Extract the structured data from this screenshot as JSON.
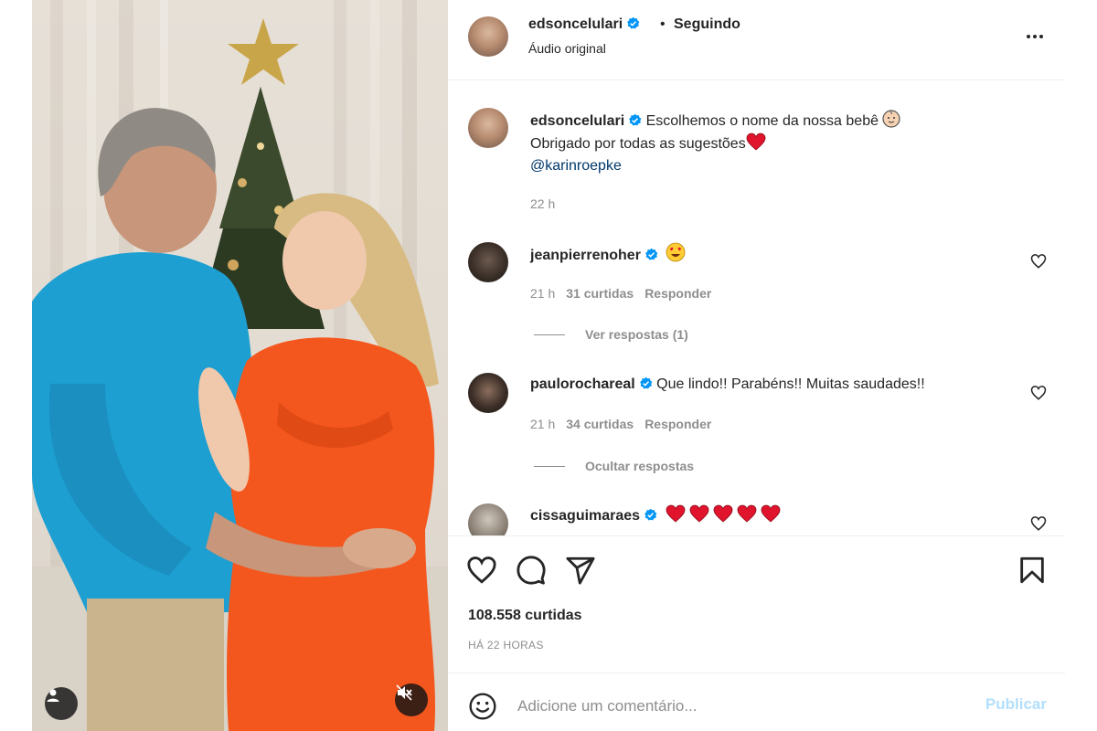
{
  "header": {
    "username": "edsoncelulari",
    "dot": "•",
    "follow_status": "Seguindo",
    "audio": "Áudio original"
  },
  "caption": {
    "username": "edsoncelulari",
    "line1": "Escolhemos o nome da nossa bebê",
    "line1_emoji": "baby-face-icon",
    "line2": "Obrigado por todas as sugestões",
    "line2_emoji": "red-heart-icon",
    "mention": "@karinroepke",
    "time": "22 h"
  },
  "comments": [
    {
      "username": "jeanpierrenoher",
      "text": "",
      "emoji": "heart-eyes-icon",
      "time": "21 h",
      "likes": "31 curtidas",
      "reply_label": "Responder",
      "replies_toggle": "Ver respostas (1)"
    },
    {
      "username": "paulorochareal",
      "text": "Que lindo!! Parabéns!! Muitas saudades!!",
      "time": "21 h",
      "likes": "34 curtidas",
      "reply_label": "Responder",
      "replies_toggle": "Ocultar respostas"
    },
    {
      "username": "cissaguimaraes",
      "text": "",
      "emoji": "red-heart-icon",
      "emoji_count": 5
    }
  ],
  "actions": {
    "likes_count": "108.558 curtidas",
    "time_ago": "HÁ 22 HORAS"
  },
  "comment_box": {
    "placeholder": "Adicione um comentário...",
    "publish_label": "Publicar"
  },
  "colors": {
    "verified": "#0095f6",
    "mention": "#00376b",
    "secondary_text": "#8e8e8e",
    "publish_disabled": "#b2dffc",
    "heart_red": "#e0142c"
  }
}
